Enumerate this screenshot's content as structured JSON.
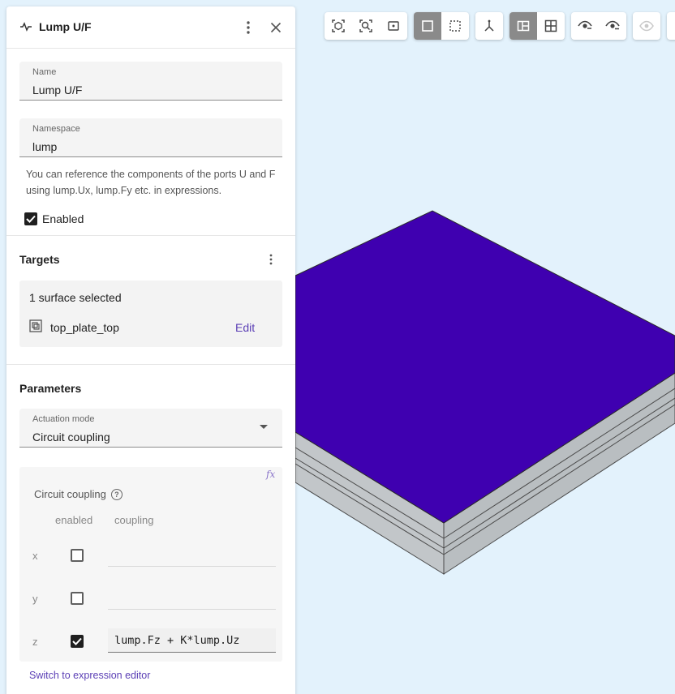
{
  "panel": {
    "title": "Lump U/F",
    "name_field": {
      "label": "Name",
      "value": "Lump U/F"
    },
    "namespace_field": {
      "label": "Namespace",
      "value": "lump"
    },
    "helper_text": "You can reference the components of the ports U and F using lump.Ux, lump.Fy etc. in expressions.",
    "enabled": {
      "label": "Enabled",
      "checked": true
    },
    "targets": {
      "title": "Targets",
      "count_text": "1 surface selected",
      "items": [
        {
          "name": "top_plate_top",
          "action": "Edit"
        }
      ]
    },
    "parameters": {
      "title": "Parameters",
      "actuation_mode": {
        "label": "Actuation mode",
        "value": "Circuit coupling"
      },
      "circuit_coupling": {
        "title": "Circuit coupling",
        "fx_label": "fx",
        "columns": [
          "enabled",
          "coupling"
        ],
        "rows": [
          {
            "axis": "x",
            "enabled": false,
            "coupling": ""
          },
          {
            "axis": "y",
            "enabled": false,
            "coupling": ""
          },
          {
            "axis": "z",
            "enabled": true,
            "coupling": "lump.Fz + K*lump.Uz"
          }
        ]
      },
      "switch_link": "Switch to expression editor"
    }
  },
  "toolbar": {
    "groups": [
      [
        "fit-all-icon",
        "zoom-fit-icon",
        "zoom-box-icon"
      ],
      [
        "select-surface-icon",
        "select-box-icon"
      ],
      [
        "axes-icon"
      ],
      [
        "split-view-icon",
        "grid-view-icon"
      ],
      [
        "hide-icon",
        "show-icon"
      ],
      [
        "show-all-icon"
      ]
    ]
  },
  "colors": {
    "accent": "#5b3fb5",
    "model_top": "#3f00b0",
    "model_side": "#bfc4c6",
    "viewport_bg": "#e3f2fc"
  }
}
